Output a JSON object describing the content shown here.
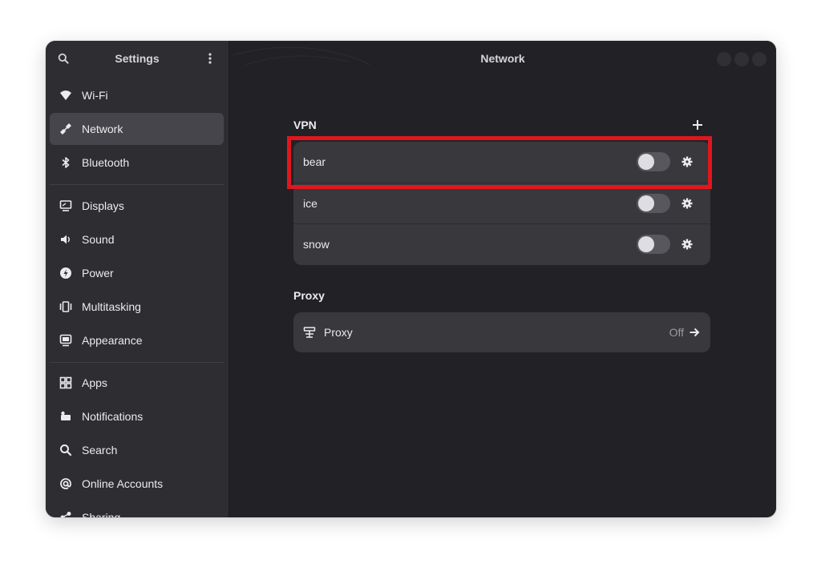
{
  "sidebar": {
    "title": "Settings",
    "search_icon": "search-icon",
    "menu_icon": "kebab-menu-icon",
    "items": [
      {
        "label": "Wi-Fi",
        "icon": "wifi-icon",
        "selected": false
      },
      {
        "label": "Network",
        "icon": "network-icon",
        "selected": true
      },
      {
        "label": "Bluetooth",
        "icon": "bluetooth-icon",
        "selected": false
      },
      {
        "label": "Displays",
        "icon": "display-icon",
        "selected": false
      },
      {
        "label": "Sound",
        "icon": "speaker-icon",
        "selected": false
      },
      {
        "label": "Power",
        "icon": "power-icon",
        "selected": false
      },
      {
        "label": "Multitasking",
        "icon": "multitasking-icon",
        "selected": false
      },
      {
        "label": "Appearance",
        "icon": "appearance-icon",
        "selected": false
      },
      {
        "label": "Apps",
        "icon": "apps-grid-icon",
        "selected": false
      },
      {
        "label": "Notifications",
        "icon": "bell-icon",
        "selected": false
      },
      {
        "label": "Search",
        "icon": "search-icon",
        "selected": false
      },
      {
        "label": "Online Accounts",
        "icon": "at-sign-icon",
        "selected": false
      },
      {
        "label": "Sharing",
        "icon": "share-icon",
        "selected": false
      }
    ]
  },
  "main": {
    "title": "Network",
    "vpn": {
      "heading": "VPN",
      "add_icon": "plus-icon",
      "connections": [
        {
          "name": "bear",
          "enabled": false,
          "settings_icon": "gear-icon"
        },
        {
          "name": "ice",
          "enabled": false,
          "settings_icon": "gear-icon"
        },
        {
          "name": "snow",
          "enabled": false,
          "settings_icon": "gear-icon"
        }
      ]
    },
    "proxy": {
      "heading": "Proxy",
      "row_label": "Proxy",
      "row_icon": "proxy-icon",
      "status": "Off",
      "arrow_icon": "arrow-right-icon"
    }
  },
  "colors": {
    "highlight": "#e0161f",
    "window_bg": "#222226",
    "sidebar_bg": "#2e2e32",
    "card_bg": "#38383d"
  }
}
